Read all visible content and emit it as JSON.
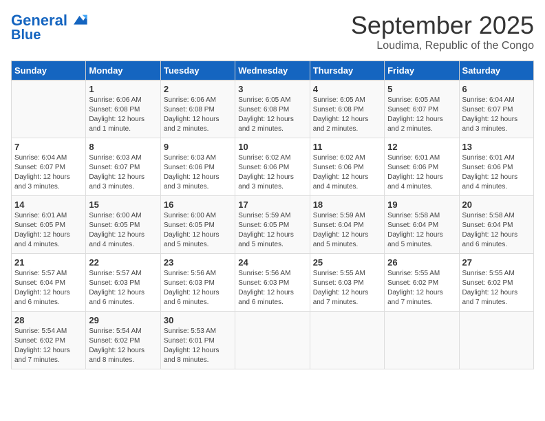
{
  "logo": {
    "line1": "General",
    "line2": "Blue"
  },
  "title": "September 2025",
  "subtitle": "Loudima, Republic of the Congo",
  "days_header": [
    "Sunday",
    "Monday",
    "Tuesday",
    "Wednesday",
    "Thursday",
    "Friday",
    "Saturday"
  ],
  "weeks": [
    [
      {
        "num": "",
        "info": ""
      },
      {
        "num": "1",
        "info": "Sunrise: 6:06 AM\nSunset: 6:08 PM\nDaylight: 12 hours\nand 1 minute."
      },
      {
        "num": "2",
        "info": "Sunrise: 6:06 AM\nSunset: 6:08 PM\nDaylight: 12 hours\nand 2 minutes."
      },
      {
        "num": "3",
        "info": "Sunrise: 6:05 AM\nSunset: 6:08 PM\nDaylight: 12 hours\nand 2 minutes."
      },
      {
        "num": "4",
        "info": "Sunrise: 6:05 AM\nSunset: 6:08 PM\nDaylight: 12 hours\nand 2 minutes."
      },
      {
        "num": "5",
        "info": "Sunrise: 6:05 AM\nSunset: 6:07 PM\nDaylight: 12 hours\nand 2 minutes."
      },
      {
        "num": "6",
        "info": "Sunrise: 6:04 AM\nSunset: 6:07 PM\nDaylight: 12 hours\nand 3 minutes."
      }
    ],
    [
      {
        "num": "7",
        "info": "Sunrise: 6:04 AM\nSunset: 6:07 PM\nDaylight: 12 hours\nand 3 minutes."
      },
      {
        "num": "8",
        "info": "Sunrise: 6:03 AM\nSunset: 6:07 PM\nDaylight: 12 hours\nand 3 minutes."
      },
      {
        "num": "9",
        "info": "Sunrise: 6:03 AM\nSunset: 6:06 PM\nDaylight: 12 hours\nand 3 minutes."
      },
      {
        "num": "10",
        "info": "Sunrise: 6:02 AM\nSunset: 6:06 PM\nDaylight: 12 hours\nand 3 minutes."
      },
      {
        "num": "11",
        "info": "Sunrise: 6:02 AM\nSunset: 6:06 PM\nDaylight: 12 hours\nand 4 minutes."
      },
      {
        "num": "12",
        "info": "Sunrise: 6:01 AM\nSunset: 6:06 PM\nDaylight: 12 hours\nand 4 minutes."
      },
      {
        "num": "13",
        "info": "Sunrise: 6:01 AM\nSunset: 6:06 PM\nDaylight: 12 hours\nand 4 minutes."
      }
    ],
    [
      {
        "num": "14",
        "info": "Sunrise: 6:01 AM\nSunset: 6:05 PM\nDaylight: 12 hours\nand 4 minutes."
      },
      {
        "num": "15",
        "info": "Sunrise: 6:00 AM\nSunset: 6:05 PM\nDaylight: 12 hours\nand 4 minutes."
      },
      {
        "num": "16",
        "info": "Sunrise: 6:00 AM\nSunset: 6:05 PM\nDaylight: 12 hours\nand 5 minutes."
      },
      {
        "num": "17",
        "info": "Sunrise: 5:59 AM\nSunset: 6:05 PM\nDaylight: 12 hours\nand 5 minutes."
      },
      {
        "num": "18",
        "info": "Sunrise: 5:59 AM\nSunset: 6:04 PM\nDaylight: 12 hours\nand 5 minutes."
      },
      {
        "num": "19",
        "info": "Sunrise: 5:58 AM\nSunset: 6:04 PM\nDaylight: 12 hours\nand 5 minutes."
      },
      {
        "num": "20",
        "info": "Sunrise: 5:58 AM\nSunset: 6:04 PM\nDaylight: 12 hours\nand 6 minutes."
      }
    ],
    [
      {
        "num": "21",
        "info": "Sunrise: 5:57 AM\nSunset: 6:04 PM\nDaylight: 12 hours\nand 6 minutes."
      },
      {
        "num": "22",
        "info": "Sunrise: 5:57 AM\nSunset: 6:03 PM\nDaylight: 12 hours\nand 6 minutes."
      },
      {
        "num": "23",
        "info": "Sunrise: 5:56 AM\nSunset: 6:03 PM\nDaylight: 12 hours\nand 6 minutes."
      },
      {
        "num": "24",
        "info": "Sunrise: 5:56 AM\nSunset: 6:03 PM\nDaylight: 12 hours\nand 6 minutes."
      },
      {
        "num": "25",
        "info": "Sunrise: 5:55 AM\nSunset: 6:03 PM\nDaylight: 12 hours\nand 7 minutes."
      },
      {
        "num": "26",
        "info": "Sunrise: 5:55 AM\nSunset: 6:02 PM\nDaylight: 12 hours\nand 7 minutes."
      },
      {
        "num": "27",
        "info": "Sunrise: 5:55 AM\nSunset: 6:02 PM\nDaylight: 12 hours\nand 7 minutes."
      }
    ],
    [
      {
        "num": "28",
        "info": "Sunrise: 5:54 AM\nSunset: 6:02 PM\nDaylight: 12 hours\nand 7 minutes."
      },
      {
        "num": "29",
        "info": "Sunrise: 5:54 AM\nSunset: 6:02 PM\nDaylight: 12 hours\nand 8 minutes."
      },
      {
        "num": "30",
        "info": "Sunrise: 5:53 AM\nSunset: 6:01 PM\nDaylight: 12 hours\nand 8 minutes."
      },
      {
        "num": "",
        "info": ""
      },
      {
        "num": "",
        "info": ""
      },
      {
        "num": "",
        "info": ""
      },
      {
        "num": "",
        "info": ""
      }
    ]
  ]
}
